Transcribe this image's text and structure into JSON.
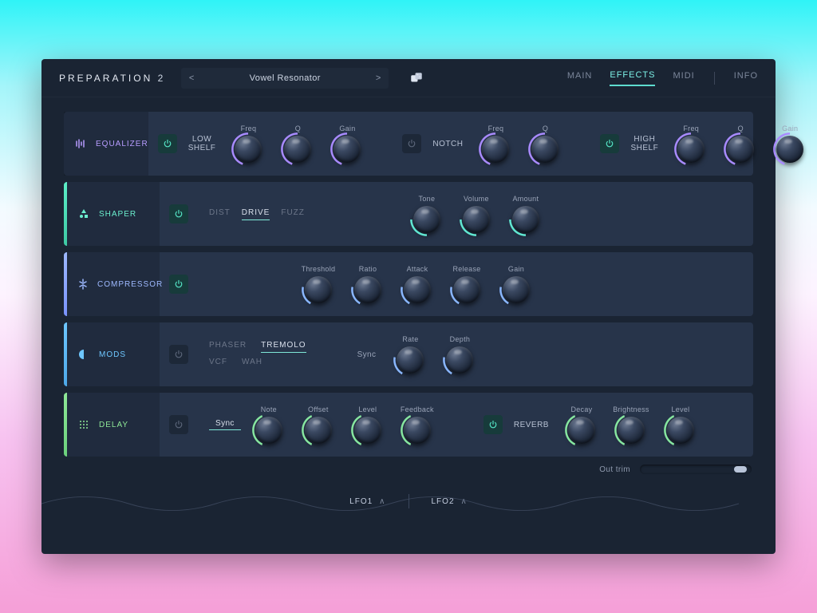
{
  "brand": {
    "name": "PREPARATION",
    "version": "2"
  },
  "preset": {
    "prev": "<",
    "next": ">",
    "name": "Vowel Resonator"
  },
  "nav": {
    "main": "MAIN",
    "effects": "EFFECTS",
    "midi": "MIDI",
    "info": "INFO",
    "active": "effects"
  },
  "eq": {
    "title": "EQUALIZER",
    "low": {
      "label": "LOW\nSHELF",
      "knobs": [
        "Freq",
        "Q",
        "Gain"
      ]
    },
    "notch": {
      "label": "NOTCH",
      "knobs": [
        "Freq",
        "Q"
      ]
    },
    "high": {
      "label": "HIGH\nSHELF",
      "knobs": [
        "Freq",
        "Q",
        "Gain"
      ]
    }
  },
  "shaper": {
    "title": "SHAPER",
    "modes": [
      "DIST",
      "DRIVE",
      "FUZZ"
    ],
    "selected": "DRIVE",
    "knobs": [
      "Tone",
      "Volume",
      "Amount"
    ]
  },
  "compressor": {
    "title": "COMPRESSOR",
    "knobs": [
      "Threshold",
      "Ratio",
      "Attack",
      "Release",
      "Gain"
    ]
  },
  "mods": {
    "title": "MODS",
    "modesTop": [
      "PHASER",
      "TREMOLO"
    ],
    "modesBottom": [
      "VCF",
      "WAH"
    ],
    "selected": "TREMOLO",
    "sync": "Sync",
    "knobs": [
      "Rate",
      "Depth"
    ]
  },
  "delay": {
    "title": "DELAY",
    "sync": "Sync",
    "knobs": [
      "Note",
      "Offset",
      "Level",
      "Feedback"
    ],
    "reverb": {
      "label": "REVERB",
      "knobs": [
        "Decay",
        "Brightness",
        "Level"
      ]
    }
  },
  "footer": {
    "outtrim_label": "Out trim",
    "lfo1": "LFO1",
    "lfo2": "LFO2"
  }
}
